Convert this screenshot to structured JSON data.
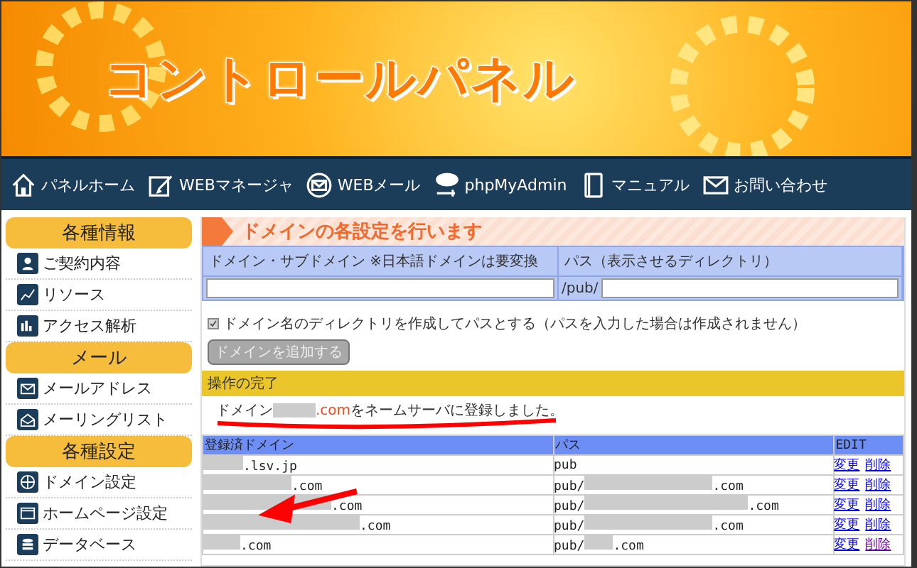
{
  "header": {
    "title": "コントロールパネル"
  },
  "nav": [
    {
      "label": "パネルホーム"
    },
    {
      "label": "WEBマネージャ"
    },
    {
      "label": "WEBメール"
    },
    {
      "label": "phpMyAdmin"
    },
    {
      "label": "マニュアル"
    },
    {
      "label": "お問い合わせ"
    }
  ],
  "sidebar": [
    {
      "heading": "各種情報",
      "items": [
        {
          "label": "ご契約内容"
        },
        {
          "label": "リソース"
        },
        {
          "label": "アクセス解析"
        }
      ]
    },
    {
      "heading": "メール",
      "items": [
        {
          "label": "メールアドレス"
        },
        {
          "label": "メーリングリスト"
        }
      ]
    },
    {
      "heading": "各種設定",
      "items": [
        {
          "label": "ドメイン設定"
        },
        {
          "label": "ホームページ設定"
        },
        {
          "label": "データベース"
        }
      ]
    }
  ],
  "main": {
    "title": "ドメインの各設定を行います",
    "form": {
      "domain_label": "ドメイン・サブドメイン ※日本語ドメインは要変換",
      "path_label": "パス（表示させるディレクトリ）",
      "path_prefix": "/pub/",
      "checkbox": {
        "label": "ドメイン名のディレクトリを作成してパスとする（パスを入力した場合は作成されません）",
        "checked": true
      },
      "submit": "ドメインを追加する",
      "submit_disabled": true
    },
    "notice": {
      "heading": "操作の完了",
      "prefix": "ドメイン",
      "domain": ".com",
      "suffix": " をネームサーバに登録しました。"
    },
    "table": {
      "columns": [
        "登録済ドメイン",
        "パス",
        "EDIT"
      ],
      "rows": [
        {
          "domain": ".lsv.jp",
          "path_prefix": "pub",
          "path": "",
          "path_redacted": false,
          "links": [
            {
              "label": "変更",
              "visited": false
            },
            {
              "label": "削除",
              "visited": false
            }
          ]
        },
        {
          "domain": ".com",
          "path_prefix": "pub/",
          "path": ".com",
          "path_redacted": true,
          "links": [
            {
              "label": "変更",
              "visited": false
            },
            {
              "label": "削除",
              "visited": false
            }
          ]
        },
        {
          "domain": ".com",
          "path_prefix": "pub/",
          "path": ".com",
          "path_redacted": true,
          "links": [
            {
              "label": "変更",
              "visited": false
            },
            {
              "label": "削除",
              "visited": false
            }
          ]
        },
        {
          "domain": ".com",
          "path_prefix": "pub/",
          "path": ".com",
          "path_redacted": true,
          "links": [
            {
              "label": "変更",
              "visited": false
            },
            {
              "label": "削除",
              "visited": false
            }
          ]
        },
        {
          "domain": ".com",
          "path_prefix": "pub/",
          "path": ".com",
          "path_redacted": true,
          "links": [
            {
              "label": "変更",
              "visited": false
            },
            {
              "label": "削除",
              "visited": true
            }
          ]
        }
      ]
    }
  }
}
